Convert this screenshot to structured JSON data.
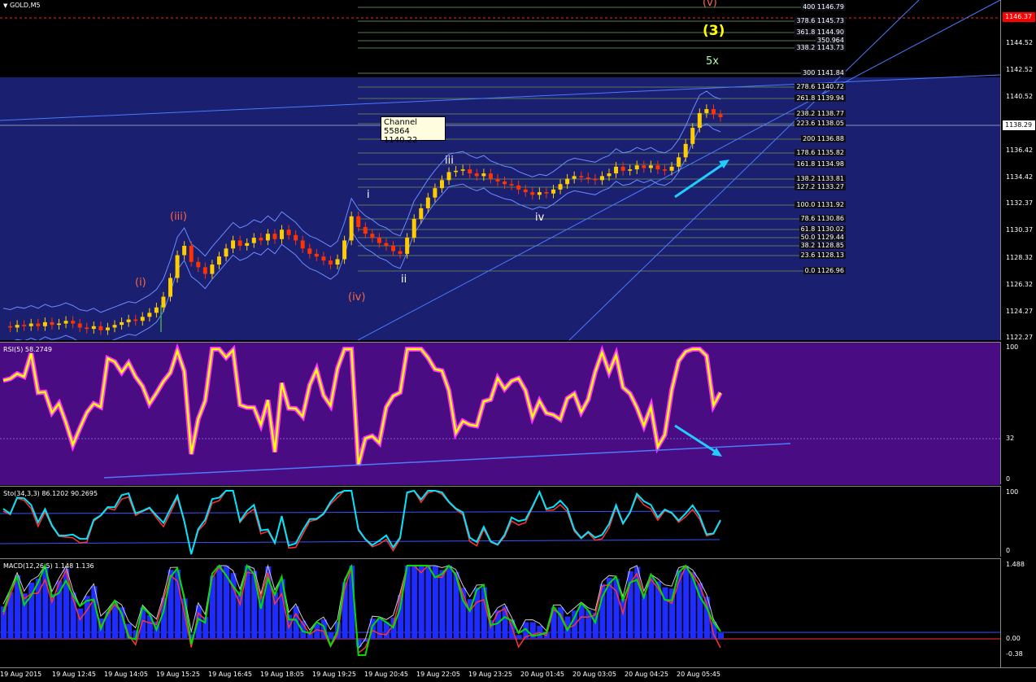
{
  "chart_title": "GOLD,M5",
  "colors": {
    "main_top": "#000000",
    "main_channel": "#1a1f70",
    "rsi_bg": "#4a0c82",
    "candle_up": "#ffcc00",
    "candle_down": "#ff3300",
    "rsi_line": "#ffff00",
    "rsi_glow": "#ff33ff",
    "stoch_main": "#00e5ff",
    "macd_hist": "#1e2cff",
    "macd_signal": "#00dd00",
    "accent_arrow": "#22ccff"
  },
  "main": {
    "price_labels": [
      "1146.37",
      "1144.52",
      "1142.52",
      "1140.52",
      "1138.29",
      "1136.42",
      "1134.42",
      "1132.37",
      "1130.37",
      "1128.32",
      "1126.32",
      "1124.27",
      "1122.27"
    ],
    "current_price": "1138.29",
    "alert_price": "1146.37",
    "tooltip": {
      "title": "Channel 55864",
      "value": "1140.22"
    },
    "fib_levels": [
      {
        "label": "400 1146.79"
      },
      {
        "label": "378.6 1145.73"
      },
      {
        "label": "361.8 1144.90"
      },
      {
        "label": "350.964"
      },
      {
        "label": "338.2 1143.73"
      },
      {
        "label": "300 1141.84"
      },
      {
        "label": "278.6 1140.72"
      },
      {
        "label": "261.8 1139.94"
      },
      {
        "label": "238.2 1138.77"
      },
      {
        "label": "223.6 1138.05"
      },
      {
        "label": "200 1136.88"
      },
      {
        "label": "178.6 1135.82"
      },
      {
        "label": "161.8 1134.98"
      },
      {
        "label": "138.2 1133.81"
      },
      {
        "label": "127.2 1133.27"
      },
      {
        "label": "100.0 1131.92"
      },
      {
        "label": "78.6 1130.86"
      },
      {
        "label": "61.8 1130.02"
      },
      {
        "label": "50.0 1129.44"
      },
      {
        "label": "38.2 1128.85"
      },
      {
        "label": "23.6 1128.13"
      },
      {
        "label": "0.0 1126.96"
      }
    ],
    "wave_labels": [
      {
        "text": "(i)",
        "color": "#ff6644"
      },
      {
        "text": "(iii)",
        "color": "#ff6644"
      },
      {
        "text": "(iv)",
        "color": "#ff6644"
      },
      {
        "text": "(v)",
        "color": "#ff6644"
      },
      {
        "text": "(3)",
        "color": "#ffff00"
      },
      {
        "text": "5x",
        "color": "#aaffaa"
      },
      {
        "text": "i",
        "color": "#ffffff"
      },
      {
        "text": "ii",
        "color": "#ffffff"
      },
      {
        "text": "iii",
        "color": "#ffffff"
      },
      {
        "text": "iv",
        "color": "#ffffff"
      }
    ]
  },
  "rsi": {
    "title": "RSI(5) 58.2749",
    "levels": [
      "100",
      "32",
      "0"
    ]
  },
  "stoch": {
    "title": "Sto(34,3,3) 86.1202 90.2695",
    "levels": [
      "100",
      "0"
    ]
  },
  "macd": {
    "title": "MACD(12,26,5) 1.148 1.136",
    "levels": [
      "1.488",
      "0.00",
      "-0.38"
    ]
  },
  "time_axis": [
    "19 Aug 2015",
    "19 Aug 12:45",
    "19 Aug 14:05",
    "19 Aug 15:25",
    "19 Aug 16:45",
    "19 Aug 18:05",
    "19 Aug 19:25",
    "19 Aug 20:45",
    "19 Aug 22:05",
    "19 Aug 23:25",
    "20 Aug 01:45",
    "20 Aug 03:05",
    "20 Aug 04:25",
    "20 Aug 05:45"
  ],
  "price_series": [
    1122.6,
    1122.5,
    1122.7,
    1122.6,
    1122.8,
    1122.6,
    1122.9,
    1122.7,
    1122.8,
    1123.0,
    1122.8,
    1122.5,
    1122.4,
    1122.6,
    1122.3,
    1122.5,
    1122.7,
    1122.9,
    1123.1,
    1123.0,
    1123.3,
    1123.6,
    1124.0,
    1124.8,
    1126.2,
    1127.9,
    1128.6,
    1127.4,
    1127.0,
    1126.5,
    1127.2,
    1127.8,
    1128.4,
    1129.0,
    1128.6,
    1128.8,
    1129.2,
    1129.0,
    1129.5,
    1129.1,
    1129.8,
    1129.4,
    1129.0,
    1128.4,
    1128.0,
    1127.8,
    1127.5,
    1127.2,
    1127.6,
    1129.0,
    1130.8,
    1130.0,
    1129.5,
    1129.2,
    1128.8,
    1128.6,
    1128.2,
    1128.0,
    1129.2,
    1130.6,
    1131.4,
    1132.2,
    1132.9,
    1133.5,
    1134.1,
    1134.2,
    1134.3,
    1134.0,
    1133.8,
    1134.0,
    1133.6,
    1133.4,
    1133.2,
    1133.1,
    1132.8,
    1132.6,
    1132.4,
    1132.6,
    1132.5,
    1132.8,
    1133.2,
    1133.6,
    1133.8,
    1133.7,
    1133.6,
    1133.5,
    1133.8,
    1134.0,
    1134.5,
    1134.2,
    1134.3,
    1134.6,
    1134.4,
    1134.6,
    1134.3,
    1134.2,
    1134.5,
    1135.2,
    1136.2,
    1137.4,
    1138.5,
    1138.8,
    1138.4,
    1138.2
  ]
}
